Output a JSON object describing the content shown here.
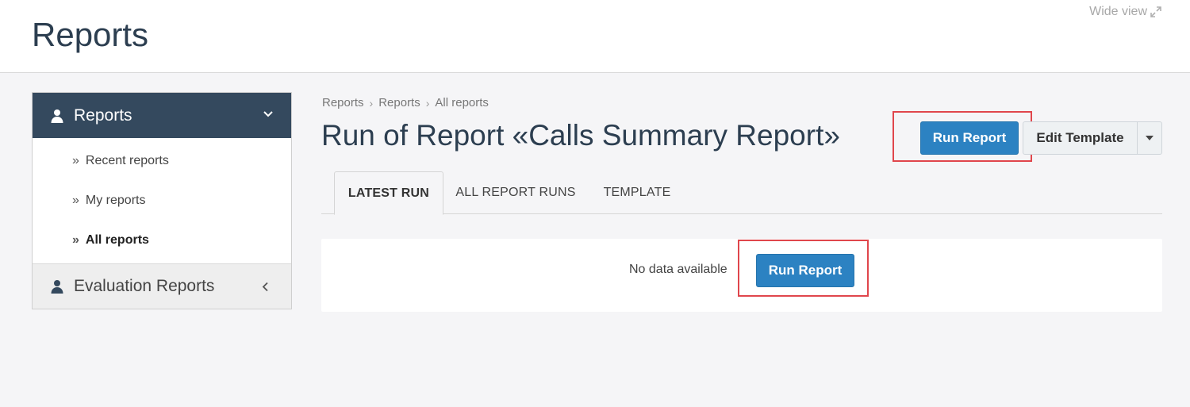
{
  "header": {
    "title": "Reports",
    "wide_view": "Wide view"
  },
  "sidebar": {
    "section_title": "Reports",
    "items": [
      {
        "label": "Recent reports",
        "active": false
      },
      {
        "label": "My reports",
        "active": false
      },
      {
        "label": "All reports",
        "active": true
      }
    ],
    "collapsed_section": "Evaluation Reports"
  },
  "breadcrumb": [
    "Reports",
    "Reports",
    "All reports"
  ],
  "report": {
    "title": "Run of Report «Calls Summary Report»"
  },
  "toolbar": {
    "run_label": "Run Report",
    "edit_template_label": "Edit Template"
  },
  "tabs": [
    {
      "label": "LATEST RUN",
      "active": true
    },
    {
      "label": "ALL REPORT RUNS",
      "active": false
    },
    {
      "label": "TEMPLATE",
      "active": false
    }
  ],
  "content": {
    "empty_message": "No data available",
    "run_label": "Run Report"
  },
  "colors": {
    "primary": "#2c82c2",
    "sidebar_header": "#34495e",
    "highlight": "#e0464c"
  }
}
